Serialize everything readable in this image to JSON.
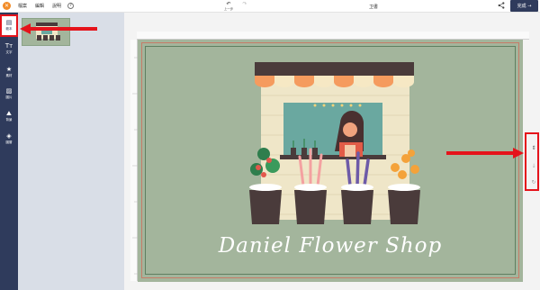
{
  "topbar": {
    "logo_glyph": "✕",
    "menu": [
      "檔案",
      "編輯",
      "說明"
    ],
    "help_glyph": "?",
    "undo_label": "上一步",
    "redo_label": "",
    "doc_title": "卫書",
    "done_label": "完成 →"
  },
  "rail": {
    "items": [
      {
        "label": "範本",
        "icon": "layout-icon",
        "glyph": "▤"
      },
      {
        "label": "文字",
        "icon": "text-icon",
        "glyph": "Tт"
      },
      {
        "label": "素材",
        "icon": "star-icon",
        "glyph": "★"
      },
      {
        "label": "圖片",
        "icon": "image-icon",
        "glyph": "▨"
      },
      {
        "label": "背景",
        "icon": "background-icon",
        "glyph": "⛰"
      },
      {
        "label": "圖層",
        "icon": "layers-icon",
        "glyph": "◈"
      }
    ]
  },
  "canvas": {
    "shop_name": "Daniel Flower Shop",
    "colors": {
      "background": "#a3b59c",
      "awning_dark": "#4a3b3b",
      "awning_orange": "#f59b5e",
      "awning_cream": "#f6e8c4",
      "wall": "#efe6c8",
      "window": "#6aa8a0",
      "pot": "#4a3b3b"
    }
  },
  "side_controls": {
    "glyphs": [
      "⇕",
      "↓",
      "↻"
    ]
  },
  "annotations": {
    "highlight_color": "#e5131b"
  }
}
